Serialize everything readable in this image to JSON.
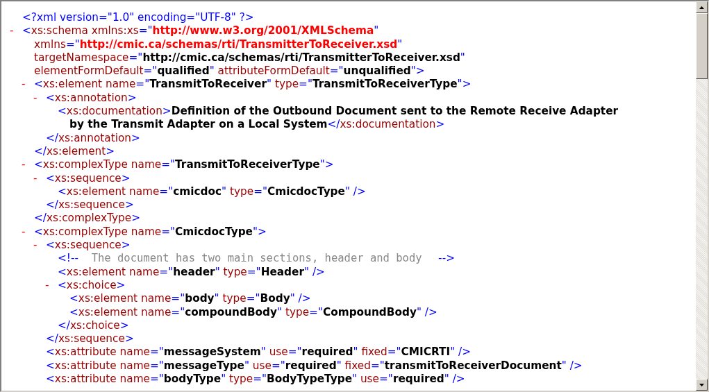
{
  "document": {
    "prolog": [
      {
        "kind": "markup",
        "text": "<?xml version=\"1.0\" encoding=\"UTF-8\" ?>"
      }
    ],
    "root": {
      "toggle": "-",
      "lines": [
        [
          {
            "kind": "markup",
            "text": "<"
          },
          {
            "kind": "name",
            "text": "xs:schema"
          },
          {
            "kind": "name",
            "text": " xmlns:xs"
          },
          {
            "kind": "markup",
            "text": "=\""
          },
          {
            "kind": "namespace",
            "text": "http://www.w3.org/2001/XMLSchema"
          },
          {
            "kind": "markup",
            "text": "\""
          }
        ],
        [
          {
            "kind": "name",
            "text": "xmlns"
          },
          {
            "kind": "markup",
            "text": "=\""
          },
          {
            "kind": "namespace",
            "text": "http://cmic.ca/schemas/rti/TransmitterToReceiver.xsd"
          },
          {
            "kind": "markup",
            "text": "\""
          }
        ],
        [
          {
            "kind": "name",
            "text": "targetNamespace"
          },
          {
            "kind": "markup",
            "text": "=\""
          },
          {
            "kind": "value",
            "text": "http://cmic.ca/schemas/rti/TransmitterToReceiver.xsd"
          },
          {
            "kind": "markup",
            "text": "\""
          }
        ],
        [
          {
            "kind": "name",
            "text": "elementFormDefault"
          },
          {
            "kind": "markup",
            "text": "=\""
          },
          {
            "kind": "value",
            "text": "qualified"
          },
          {
            "kind": "markup",
            "text": "\""
          },
          {
            "kind": "name",
            "text": " attributeFormDefault"
          },
          {
            "kind": "markup",
            "text": "=\""
          },
          {
            "kind": "value",
            "text": "unqualified"
          },
          {
            "kind": "markup",
            "text": "\">"
          }
        ]
      ],
      "children": [
        {
          "toggle": "-",
          "lines": [
            [
              {
                "kind": "markup",
                "text": "<"
              },
              {
                "kind": "name",
                "text": "xs:element"
              },
              {
                "kind": "name",
                "text": " name"
              },
              {
                "kind": "markup",
                "text": "=\""
              },
              {
                "kind": "value",
                "text": "TransmitToReceiver"
              },
              {
                "kind": "markup",
                "text": "\""
              },
              {
                "kind": "name",
                "text": " type"
              },
              {
                "kind": "markup",
                "text": "=\""
              },
              {
                "kind": "value",
                "text": "TransmitToReceiverType"
              },
              {
                "kind": "markup",
                "text": "\">"
              }
            ]
          ],
          "children": [
            {
              "toggle": "-",
              "lines": [
                [
                  {
                    "kind": "markup",
                    "text": "<"
                  },
                  {
                    "kind": "name",
                    "text": "xs:annotation"
                  },
                  {
                    "kind": "markup",
                    "text": ">"
                  }
                ]
              ],
              "children": [
                {
                  "lines": [
                    [
                      {
                        "kind": "markup",
                        "text": "<"
                      },
                      {
                        "kind": "name",
                        "text": "xs:documentation"
                      },
                      {
                        "kind": "markup",
                        "text": ">"
                      },
                      {
                        "kind": "text",
                        "text": "Definition of the Outbound Document sent to the Remote Receive Adapter"
                      }
                    ],
                    [
                      {
                        "kind": "text",
                        "text": "by the Transmit Adapter on a Local System"
                      },
                      {
                        "kind": "markup",
                        "text": "</"
                      },
                      {
                        "kind": "name",
                        "text": "xs:documentation"
                      },
                      {
                        "kind": "markup",
                        "text": ">"
                      }
                    ]
                  ]
                }
              ],
              "close": [
                {
                  "kind": "markup",
                  "text": "</"
                },
                {
                  "kind": "name",
                  "text": "xs:annotation"
                },
                {
                  "kind": "markup",
                  "text": ">"
                }
              ]
            }
          ],
          "close": [
            {
              "kind": "markup",
              "text": "</"
            },
            {
              "kind": "name",
              "text": "xs:element"
            },
            {
              "kind": "markup",
              "text": ">"
            }
          ]
        },
        {
          "toggle": "-",
          "lines": [
            [
              {
                "kind": "markup",
                "text": "<"
              },
              {
                "kind": "name",
                "text": "xs:complexType"
              },
              {
                "kind": "name",
                "text": " name"
              },
              {
                "kind": "markup",
                "text": "=\""
              },
              {
                "kind": "value",
                "text": "TransmitToReceiverType"
              },
              {
                "kind": "markup",
                "text": "\">"
              }
            ]
          ],
          "children": [
            {
              "toggle": "-",
              "lines": [
                [
                  {
                    "kind": "markup",
                    "text": "<"
                  },
                  {
                    "kind": "name",
                    "text": "xs:sequence"
                  },
                  {
                    "kind": "markup",
                    "text": ">"
                  }
                ]
              ],
              "children": [
                {
                  "lines": [
                    [
                      {
                        "kind": "markup",
                        "text": "<"
                      },
                      {
                        "kind": "name",
                        "text": "xs:element"
                      },
                      {
                        "kind": "name",
                        "text": " name"
                      },
                      {
                        "kind": "markup",
                        "text": "=\""
                      },
                      {
                        "kind": "value",
                        "text": "cmicdoc"
                      },
                      {
                        "kind": "markup",
                        "text": "\""
                      },
                      {
                        "kind": "name",
                        "text": " type"
                      },
                      {
                        "kind": "markup",
                        "text": "=\""
                      },
                      {
                        "kind": "value",
                        "text": "CmicdocType"
                      },
                      {
                        "kind": "markup",
                        "text": "\" />"
                      }
                    ]
                  ]
                }
              ],
              "close": [
                {
                  "kind": "markup",
                  "text": "</"
                },
                {
                  "kind": "name",
                  "text": "xs:sequence"
                },
                {
                  "kind": "markup",
                  "text": ">"
                }
              ]
            }
          ],
          "close": [
            {
              "kind": "markup",
              "text": "</"
            },
            {
              "kind": "name",
              "text": "xs:complexType"
            },
            {
              "kind": "markup",
              "text": ">"
            }
          ]
        },
        {
          "toggle": "-",
          "lines": [
            [
              {
                "kind": "markup",
                "text": "<"
              },
              {
                "kind": "name",
                "text": "xs:complexType"
              },
              {
                "kind": "name",
                "text": " name"
              },
              {
                "kind": "markup",
                "text": "=\""
              },
              {
                "kind": "value",
                "text": "CmicdocType"
              },
              {
                "kind": "markup",
                "text": "\">"
              }
            ]
          ],
          "children": [
            {
              "toggle": "-",
              "lines": [
                [
                  {
                    "kind": "markup",
                    "text": "<"
                  },
                  {
                    "kind": "name",
                    "text": "xs:sequence"
                  },
                  {
                    "kind": "markup",
                    "text": ">"
                  }
                ]
              ],
              "children": [
                {
                  "lines": [
                    [
                      {
                        "kind": "markup",
                        "text": "<!--"
                      },
                      {
                        "kind": "comment",
                        "text": "  The document has two main sections, header and body  "
                      },
                      {
                        "kind": "markup",
                        "text": " -->"
                      }
                    ]
                  ]
                },
                {
                  "lines": [
                    [
                      {
                        "kind": "markup",
                        "text": "<"
                      },
                      {
                        "kind": "name",
                        "text": "xs:element"
                      },
                      {
                        "kind": "name",
                        "text": " name"
                      },
                      {
                        "kind": "markup",
                        "text": "=\""
                      },
                      {
                        "kind": "value",
                        "text": "header"
                      },
                      {
                        "kind": "markup",
                        "text": "\""
                      },
                      {
                        "kind": "name",
                        "text": " type"
                      },
                      {
                        "kind": "markup",
                        "text": "=\""
                      },
                      {
                        "kind": "value",
                        "text": "Header"
                      },
                      {
                        "kind": "markup",
                        "text": "\" />"
                      }
                    ]
                  ]
                },
                {
                  "toggle": "-",
                  "lines": [
                    [
                      {
                        "kind": "markup",
                        "text": "<"
                      },
                      {
                        "kind": "name",
                        "text": "xs:choice"
                      },
                      {
                        "kind": "markup",
                        "text": ">"
                      }
                    ]
                  ],
                  "children": [
                    {
                      "lines": [
                        [
                          {
                            "kind": "markup",
                            "text": "<"
                          },
                          {
                            "kind": "name",
                            "text": "xs:element"
                          },
                          {
                            "kind": "name",
                            "text": " name"
                          },
                          {
                            "kind": "markup",
                            "text": "=\""
                          },
                          {
                            "kind": "value",
                            "text": "body"
                          },
                          {
                            "kind": "markup",
                            "text": "\""
                          },
                          {
                            "kind": "name",
                            "text": " type"
                          },
                          {
                            "kind": "markup",
                            "text": "=\""
                          },
                          {
                            "kind": "value",
                            "text": "Body"
                          },
                          {
                            "kind": "markup",
                            "text": "\" />"
                          }
                        ]
                      ]
                    },
                    {
                      "lines": [
                        [
                          {
                            "kind": "markup",
                            "text": "<"
                          },
                          {
                            "kind": "name",
                            "text": "xs:element"
                          },
                          {
                            "kind": "name",
                            "text": " name"
                          },
                          {
                            "kind": "markup",
                            "text": "=\""
                          },
                          {
                            "kind": "value",
                            "text": "compoundBody"
                          },
                          {
                            "kind": "markup",
                            "text": "\""
                          },
                          {
                            "kind": "name",
                            "text": " type"
                          },
                          {
                            "kind": "markup",
                            "text": "=\""
                          },
                          {
                            "kind": "value",
                            "text": "CompoundBody"
                          },
                          {
                            "kind": "markup",
                            "text": "\" />"
                          }
                        ]
                      ]
                    }
                  ],
                  "close": [
                    {
                      "kind": "markup",
                      "text": "</"
                    },
                    {
                      "kind": "name",
                      "text": "xs:choice"
                    },
                    {
                      "kind": "markup",
                      "text": ">"
                    }
                  ]
                }
              ],
              "close": [
                {
                  "kind": "markup",
                  "text": "</"
                },
                {
                  "kind": "name",
                  "text": "xs:sequence"
                },
                {
                  "kind": "markup",
                  "text": ">"
                }
              ]
            },
            {
              "lines": [
                [
                  {
                    "kind": "markup",
                    "text": "<"
                  },
                  {
                    "kind": "name",
                    "text": "xs:attribute"
                  },
                  {
                    "kind": "name",
                    "text": " name"
                  },
                  {
                    "kind": "markup",
                    "text": "=\""
                  },
                  {
                    "kind": "value",
                    "text": "messageSystem"
                  },
                  {
                    "kind": "markup",
                    "text": "\""
                  },
                  {
                    "kind": "name",
                    "text": " use"
                  },
                  {
                    "kind": "markup",
                    "text": "=\""
                  },
                  {
                    "kind": "value",
                    "text": "required"
                  },
                  {
                    "kind": "markup",
                    "text": "\""
                  },
                  {
                    "kind": "name",
                    "text": " fixed"
                  },
                  {
                    "kind": "markup",
                    "text": "=\""
                  },
                  {
                    "kind": "value",
                    "text": "CMICRTI"
                  },
                  {
                    "kind": "markup",
                    "text": "\" />"
                  }
                ]
              ]
            },
            {
              "lines": [
                [
                  {
                    "kind": "markup",
                    "text": "<"
                  },
                  {
                    "kind": "name",
                    "text": "xs:attribute"
                  },
                  {
                    "kind": "name",
                    "text": " name"
                  },
                  {
                    "kind": "markup",
                    "text": "=\""
                  },
                  {
                    "kind": "value",
                    "text": "messageType"
                  },
                  {
                    "kind": "markup",
                    "text": "\""
                  },
                  {
                    "kind": "name",
                    "text": " use"
                  },
                  {
                    "kind": "markup",
                    "text": "=\""
                  },
                  {
                    "kind": "value",
                    "text": "required"
                  },
                  {
                    "kind": "markup",
                    "text": "\""
                  },
                  {
                    "kind": "name",
                    "text": " fixed"
                  },
                  {
                    "kind": "markup",
                    "text": "=\""
                  },
                  {
                    "kind": "value",
                    "text": "transmitToReceiverDocument"
                  },
                  {
                    "kind": "markup",
                    "text": "\" />"
                  }
                ]
              ]
            },
            {
              "lines": [
                [
                  {
                    "kind": "markup",
                    "text": "<"
                  },
                  {
                    "kind": "name",
                    "text": "xs:attribute"
                  },
                  {
                    "kind": "name",
                    "text": " name"
                  },
                  {
                    "kind": "markup",
                    "text": "=\""
                  },
                  {
                    "kind": "value",
                    "text": "bodyType"
                  },
                  {
                    "kind": "markup",
                    "text": "\""
                  },
                  {
                    "kind": "name",
                    "text": " type"
                  },
                  {
                    "kind": "markup",
                    "text": "=\""
                  },
                  {
                    "kind": "value",
                    "text": "BodyTypeType"
                  },
                  {
                    "kind": "markup",
                    "text": "\""
                  },
                  {
                    "kind": "name",
                    "text": " use"
                  },
                  {
                    "kind": "markup",
                    "text": "=\""
                  },
                  {
                    "kind": "value",
                    "text": "required"
                  },
                  {
                    "kind": "markup",
                    "text": "\" />"
                  }
                ]
              ]
            }
          ]
        }
      ]
    }
  }
}
